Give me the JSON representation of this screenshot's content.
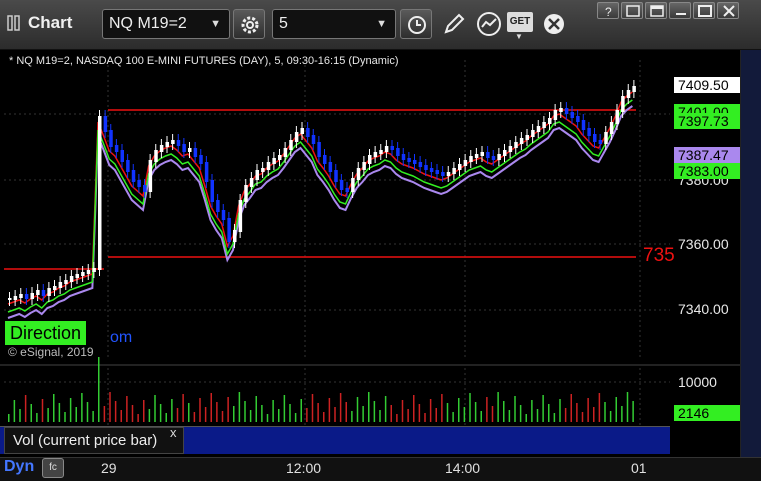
{
  "window": {
    "title": "Chart"
  },
  "toolbar": {
    "symbol_value": "NQ M19=2",
    "interval_value": "5",
    "get_label": "GET"
  },
  "chart": {
    "description": "* NQ M19=2, NASDAQ 100 E-MINI FUTURES (DAY), 5, 09:30-16:15 (Dynamic)",
    "copyright": "© eSignal, 2019",
    "direction_label": "Direction",
    "direction_suffix": "om",
    "line_label": "735",
    "price_axis": [
      "7360.00",
      "7340.00",
      "7380.00"
    ],
    "price_tags": {
      "last": "7409.50",
      "level_1": "7401.00",
      "level_2": "7397.73",
      "level_3": "7387.47",
      "level_4": "7383.00"
    },
    "colors": {
      "up_candle": "#ffffff",
      "down_candle": "#1133ff",
      "level_line": "#ee1111",
      "ma_fast": "#ee1111",
      "ma_mid": "#33ee22",
      "ma_slow": "#aa88ee",
      "volume_up": "#33cc33",
      "volume_down": "#cc2222"
    }
  },
  "volume": {
    "label": "Vol (current price bar)",
    "close_label": "x",
    "axis_label": "10000",
    "current": "2146"
  },
  "time_axis": {
    "mode": "Dyn",
    "labels": [
      "29",
      "12:00",
      "14:00",
      "01"
    ]
  }
}
